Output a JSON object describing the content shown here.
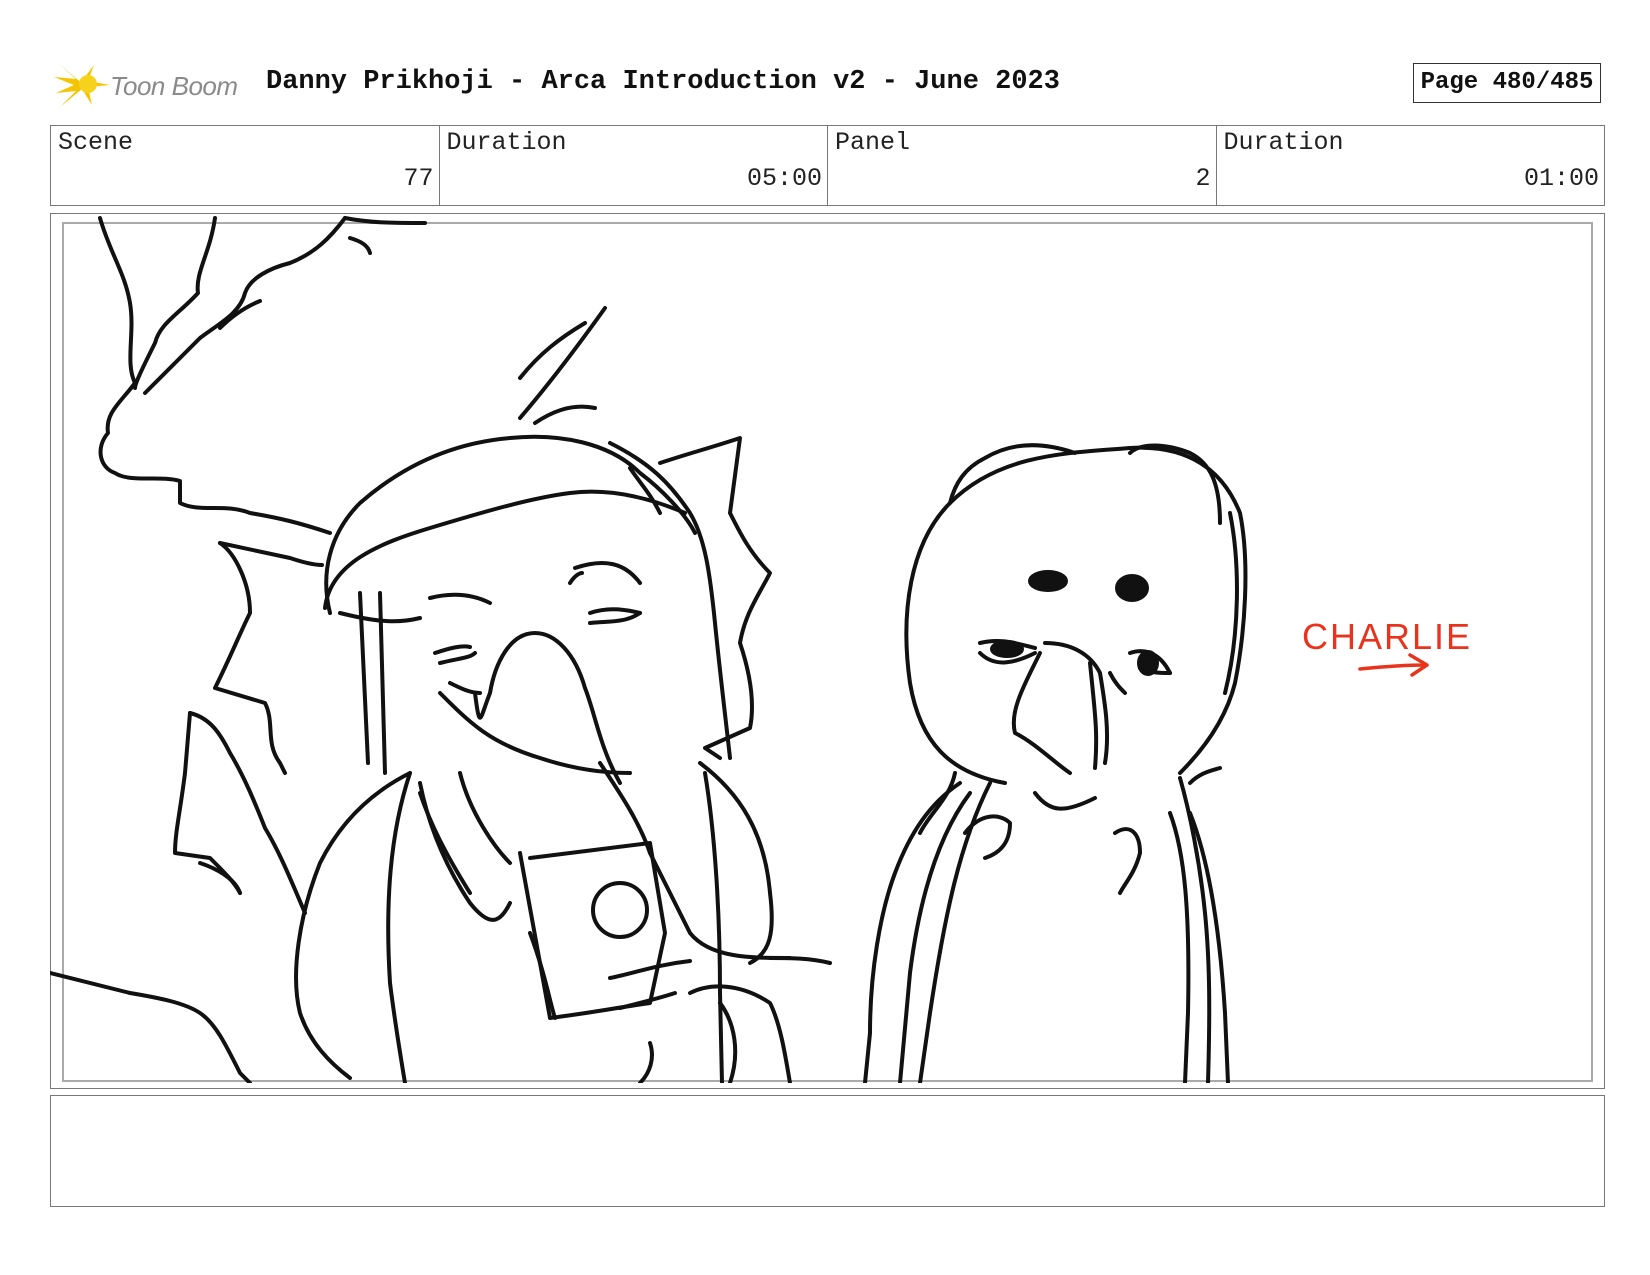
{
  "header": {
    "logo_text": "Toon Boom",
    "title": "Danny Prikhoji - Arca Introduction v2 - June 2023",
    "page": "Page 480/485"
  },
  "info": {
    "scene_label": "Scene",
    "scene_value": "77",
    "scene_duration_label": "Duration",
    "scene_duration_value": "05:00",
    "panel_label": "Panel",
    "panel_value": "2",
    "panel_duration_label": "Duration",
    "panel_duration_value": "01:00"
  },
  "panel": {
    "annotation_text": "CHARLIE",
    "annotation_color": "#e8341c",
    "line_color": "#111111"
  },
  "notes": {
    "text": ""
  },
  "colors": {
    "logo_yellow": "#f5c400",
    "logo_grey": "#8a8a8a",
    "border": "#777777"
  }
}
